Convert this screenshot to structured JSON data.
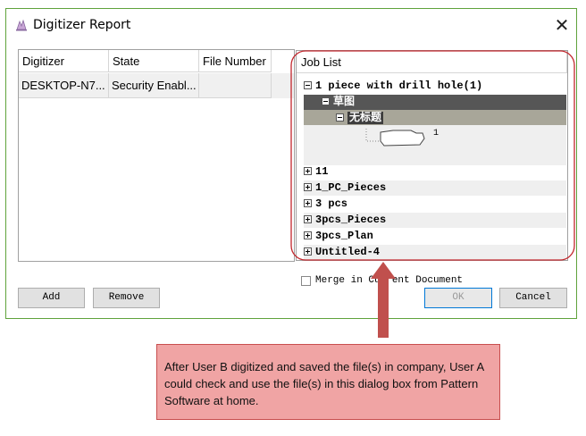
{
  "dialog": {
    "title": "Digitizer Report",
    "close_glyph": "✕",
    "icon": "app-icon"
  },
  "table": {
    "columns": [
      "Digitizer",
      "State",
      "File Number"
    ],
    "rows": [
      {
        "digitizer": "DESKTOP-N7...",
        "state": "Security Enabl...",
        "file_number": ""
      }
    ]
  },
  "job_list": {
    "header": "Job List",
    "items": [
      {
        "label": "1 piece with drill hole(1)",
        "expanded": true
      },
      {
        "label": "草图",
        "expanded": true
      },
      {
        "label": "无标题",
        "expanded": true
      },
      {
        "label": "11",
        "expanded": false
      },
      {
        "label": "1_PC_Pieces",
        "expanded": false
      },
      {
        "label": "3 pcs",
        "expanded": false
      },
      {
        "label": "3pcs_Pieces",
        "expanded": false
      },
      {
        "label": "3pcs_Plan",
        "expanded": false
      },
      {
        "label": "Untitled-4",
        "expanded": false
      }
    ],
    "piece_count_label": "1"
  },
  "merge_checkbox": {
    "label": "Merge in Current Document",
    "checked": false
  },
  "buttons": {
    "add": "Add",
    "remove": "Remove",
    "ok": "OK",
    "cancel": "Cancel"
  },
  "callout": {
    "text": "After User B digitized and saved the file(s) in company, User A could check and use the file(s) in this dialog box from Pattern Software  at home."
  },
  "colors": {
    "dialog_border": "#5fa33b",
    "annotation_red": "#c2272d",
    "callout_fill": "#f0a4a4",
    "tree_dark_band": "#565656",
    "tree_mid_band": "#a8a699"
  }
}
